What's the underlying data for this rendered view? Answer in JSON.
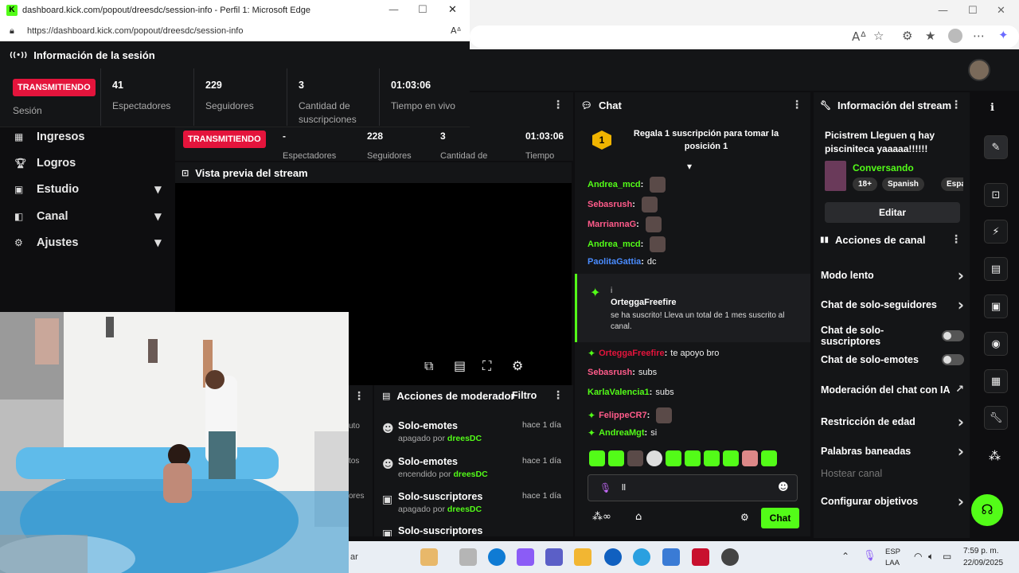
{
  "popout": {
    "window_title": "dashboard.kick.com/popout/dreesdc/session-info - Perfil 1: Microsoft Edge",
    "url": "https://dashboard.kick.com/popout/dreesdc/session-info",
    "header": "Información de la sesión",
    "status_badge": "TRANSMITIENDO",
    "session_label": "Sesión",
    "stats": [
      {
        "value": "41",
        "label": "Espectadores"
      },
      {
        "value": "229",
        "label": "Seguidores"
      },
      {
        "value": "3",
        "label": "Cantidad de suscripciones"
      },
      {
        "value": "01:03:06",
        "label": "Tiempo en vivo"
      }
    ]
  },
  "bg_stats": {
    "badge": "TRANSMITIENDO",
    "values": [
      "-",
      "228",
      "3",
      "01:03:06"
    ],
    "labels": [
      "Espectadores",
      "Seguidores",
      "Cantidad de",
      "Tiempo"
    ]
  },
  "sidebar": {
    "items": [
      {
        "label": "Ingresos",
        "icon": "bank-icon"
      },
      {
        "label": "Logros",
        "icon": "trophy-icon"
      },
      {
        "label": "Estudio",
        "icon": "studio-icon"
      },
      {
        "label": "Canal",
        "icon": "channel-icon"
      },
      {
        "label": "Ajustes",
        "icon": "gear-icon"
      }
    ]
  },
  "preview": {
    "title": "Vista previa del stream"
  },
  "moderator": {
    "title": "Acciones de moderador",
    "filter": "Filtro",
    "items": [
      {
        "title": "Solo-emotes",
        "state": "apagado por",
        "user": "dreesDC",
        "time": "hace 1 día"
      },
      {
        "title": "Solo-emotes",
        "state": "encendido por",
        "user": "dreesDC",
        "time": "hace 1 día"
      },
      {
        "title": "Solo-suscriptores",
        "state": "apagado por",
        "user": "dreesDC",
        "time": "hace 1 día"
      },
      {
        "title": "Solo-suscriptores",
        "state": "",
        "user": "",
        "time": ""
      }
    ],
    "partial_labels": [
      "uto",
      "tos",
      "ores"
    ]
  },
  "chat": {
    "title": "Chat",
    "gift_text": "Regala 1 suscripción para tomar la posición 1",
    "gift_rank": "1",
    "messages": [
      {
        "user": "Andrea_mcd",
        "color": "#53fc18",
        "text": ""
      },
      {
        "user": "Sebasrush",
        "color": "#ff5b8a",
        "text": ""
      },
      {
        "user": "MarriannaG",
        "color": "#ff5b8a",
        "text": ""
      },
      {
        "user": "Andrea_mcd",
        "color": "#53fc18",
        "text": ""
      },
      {
        "user": "PaolitaGattia",
        "color": "#4a8cff",
        "text": "dc"
      }
    ],
    "sub_event": {
      "prefix": "i",
      "user": "OrteggaFreefire",
      "text": "se ha suscrito! Lleva un total de 1 mes suscrito al canal."
    },
    "messages2": [
      {
        "user": "OrteggaFreefire",
        "color": "#e4143c",
        "text": "te apoyo bro"
      },
      {
        "user": "Sebasrush",
        "color": "#ff5b8a",
        "text": "subs"
      },
      {
        "user": "KarlaValencia1",
        "color": "#53fc18",
        "text": "subs"
      },
      {
        "user": "FelippeCR7",
        "color": "#ff5b8a",
        "text": ""
      },
      {
        "user": "AndreaMgt",
        "color": "#53fc18",
        "text": "si"
      }
    ],
    "input_value": "ll",
    "send_label": "Chat"
  },
  "stream_info": {
    "title": "Información del stream",
    "stream_title": "Picistrem Lleguen q hay pisciniteca yaaaaa!!!!!!",
    "category": "Conversando",
    "tags": [
      "18+",
      "Spanish",
      "Españo"
    ],
    "edit_label": "Editar"
  },
  "channel_actions": {
    "title": "Acciones de canal",
    "rows": [
      {
        "label": "Modo lento",
        "kind": "arrow"
      },
      {
        "label": "Chat de solo-seguidores",
        "kind": "arrow"
      },
      {
        "label": "Chat de solo-suscriptores",
        "kind": "toggle"
      },
      {
        "label": "Chat de solo-emotes",
        "kind": "toggle"
      },
      {
        "label": "Moderación del chat con IA",
        "kind": "external"
      },
      {
        "label": "Restricción de edad",
        "kind": "arrow"
      },
      {
        "label": "Palabras baneadas",
        "kind": "arrow"
      },
      {
        "label": "Hostear canal",
        "kind": "disabled"
      },
      {
        "label": "Configurar objetivos",
        "kind": "arrow"
      }
    ]
  },
  "taskbar": {
    "search_fragment": "ar",
    "lang_top": "ESP",
    "lang_bottom": "LAA",
    "time": "7:59 p. m.",
    "date": "22/09/2025"
  },
  "colors": {
    "accent": "#53fc18",
    "live": "#e4143c",
    "panel": "#141517"
  }
}
